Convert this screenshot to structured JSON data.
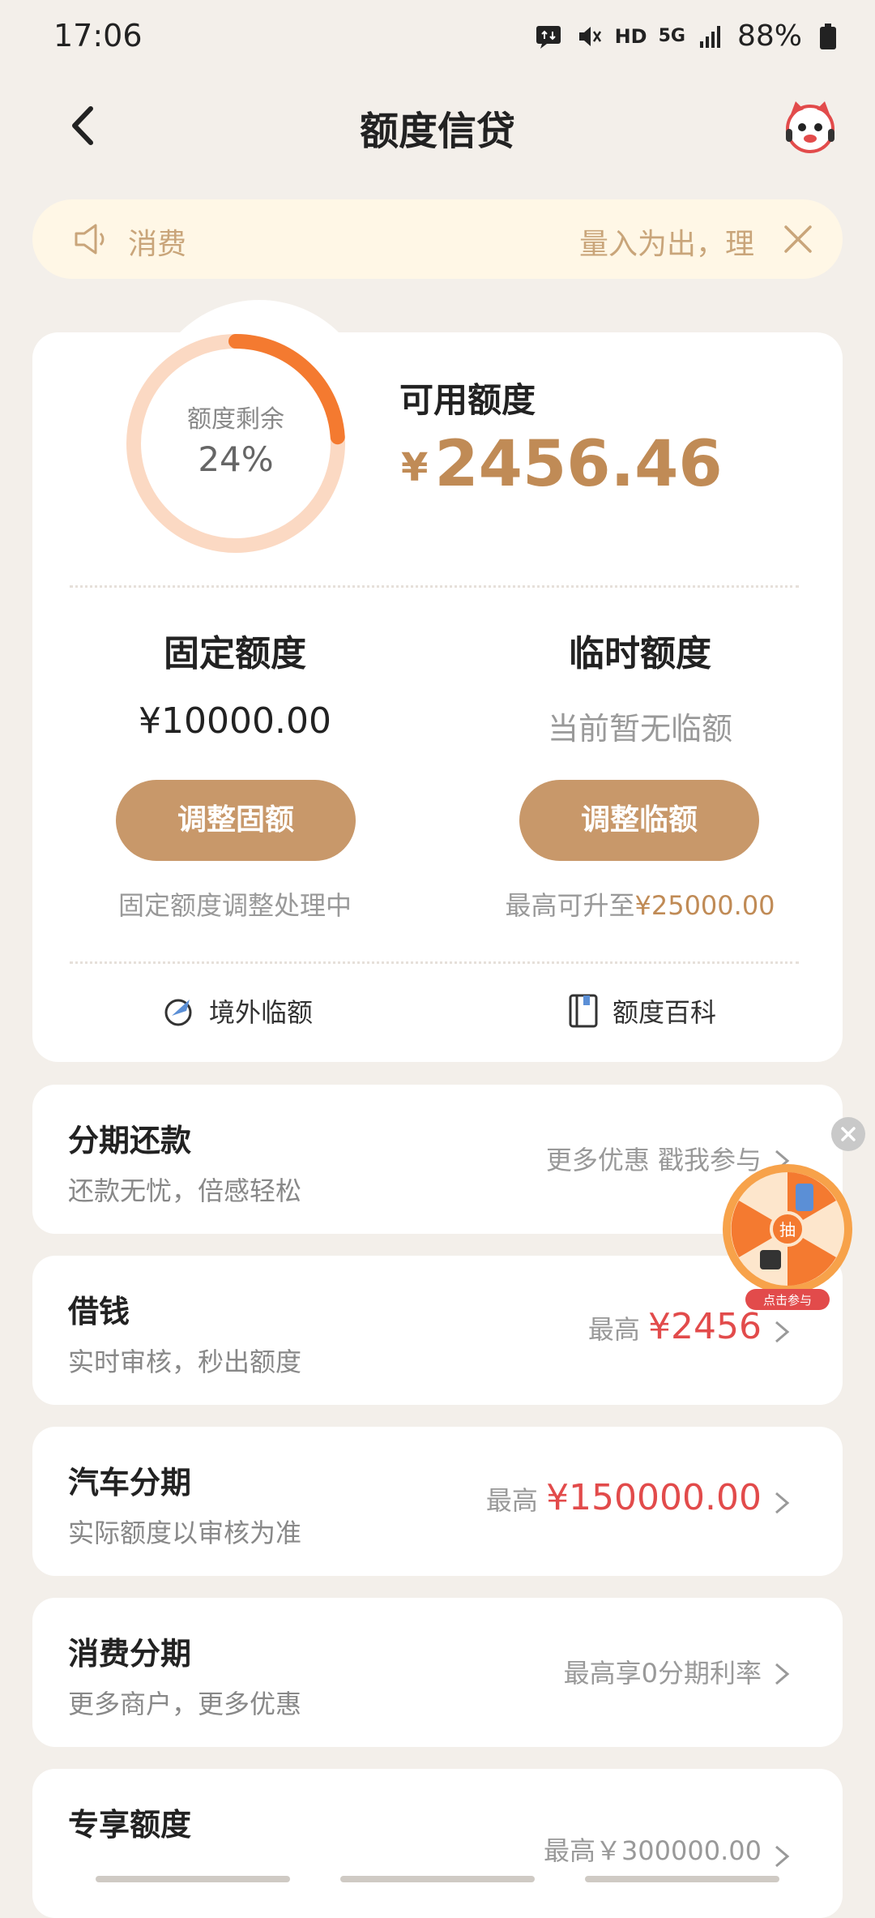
{
  "status": {
    "time": "17:06",
    "network": "HD",
    "signal_gen": "5G",
    "battery": "88%"
  },
  "header": {
    "title": "额度信贷"
  },
  "notice": {
    "left": "消费",
    "right": "量入为出，理"
  },
  "credit": {
    "gauge_label": "额度剩余",
    "gauge_percent": "24%",
    "gauge_fraction": 0.24,
    "available_label": "可用额度",
    "currency": "¥",
    "available_amount": "2456.46",
    "fixed": {
      "title": "固定额度",
      "value": "¥10000.00",
      "button": "调整固额",
      "note": "固定额度调整处理中"
    },
    "temp": {
      "title": "临时额度",
      "value": "当前暂无临额",
      "button": "调整临额",
      "note_prefix": "最高可升至",
      "note_amount": "¥25000.00"
    },
    "links": {
      "overseas": "境外临额",
      "wiki": "额度百科"
    }
  },
  "list": [
    {
      "title": "分期还款",
      "subtitle": "还款无忧，倍感轻松",
      "right": "更多优惠 戳我参与"
    },
    {
      "title": "借钱",
      "subtitle": "实时审核，秒出额度",
      "right_prefix": "最高 ",
      "right_amount": "¥2456"
    },
    {
      "title": "汽车分期",
      "subtitle": "实际额度以审核为准",
      "right_prefix": "最高 ",
      "right_amount": "¥150000.00"
    },
    {
      "title": "消费分期",
      "subtitle": "更多商户，更多优惠",
      "right": "最高享0分期利率"
    },
    {
      "title": "专享额度",
      "subtitle": "",
      "right": "最高￥300000.00"
    }
  ],
  "wheel": {
    "center": "抽",
    "button": "点击参与"
  },
  "colors": {
    "accent": "#c8986a",
    "amount": "#c08b56",
    "red": "#e24b4b",
    "gauge": "#f47a30",
    "gauge_track": "#fbd9c3"
  }
}
